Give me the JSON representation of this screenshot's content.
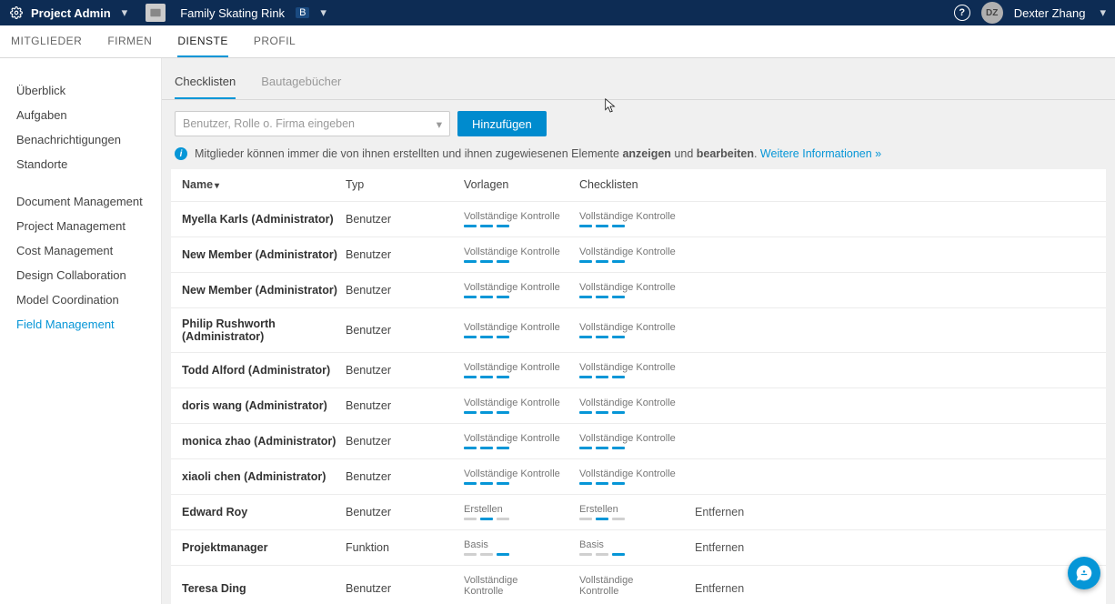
{
  "header": {
    "app_title": "Project Admin",
    "project_name": "Family Skating Rink",
    "project_badge": "B",
    "user_initials": "DZ",
    "user_name": "Dexter Zhang"
  },
  "top_tabs": [
    "MITGLIEDER",
    "FIRMEN",
    "DIENSTE",
    "PROFIL"
  ],
  "top_tab_active": 2,
  "sidebar": {
    "group1": [
      "Überblick",
      "Aufgaben",
      "Benachrichtigungen",
      "Standorte"
    ],
    "group2": [
      "Document Management",
      "Project Management",
      "Cost Management",
      "Design Collaboration",
      "Model Coordination",
      "Field Management"
    ],
    "active": "Field Management"
  },
  "content_tabs": [
    "Checklisten",
    "Bautagebücher"
  ],
  "content_tab_active": 0,
  "controls": {
    "placeholder": "Benutzer, Rolle o. Firma eingeben",
    "add_btn": "Hinzufügen"
  },
  "info": {
    "t1": "Mitglieder können immer die von ihnen erstellten und ihnen zugewiesenen Elemente ",
    "b1": "anzeigen",
    "t2": " und ",
    "b2": "bearbeiten",
    "t3": ". ",
    "link": "Weitere Informationen »"
  },
  "columns": {
    "name": "Name",
    "typ": "Typ",
    "vor": "Vorlagen",
    "chk": "Checklisten"
  },
  "perm_labels": {
    "full": "Vollständige Kontrolle",
    "create": "Erstellen",
    "basis": "Basis",
    "full_wrap": "Vollständige\nKontrolle"
  },
  "action_remove": "Entfernen",
  "rows": [
    {
      "name": "Myella Karls (Administrator)",
      "typ": "Benutzer",
      "vor": "full3",
      "chk": "full3",
      "act": ""
    },
    {
      "name": "New Member (Administrator)",
      "typ": "Benutzer",
      "vor": "full3",
      "chk": "full3",
      "act": ""
    },
    {
      "name": "New Member (Administrator)",
      "typ": "Benutzer",
      "vor": "full3",
      "chk": "full3",
      "act": ""
    },
    {
      "name": "Philip Rushworth (Administrator)",
      "typ": "Benutzer",
      "vor": "full3",
      "chk": "full3",
      "act": ""
    },
    {
      "name": "Todd Alford (Administrator)",
      "typ": "Benutzer",
      "vor": "full3",
      "chk": "full3",
      "act": ""
    },
    {
      "name": "doris wang (Administrator)",
      "typ": "Benutzer",
      "vor": "full3",
      "chk": "full3",
      "act": ""
    },
    {
      "name": "monica zhao (Administrator)",
      "typ": "Benutzer",
      "vor": "full3",
      "chk": "full3",
      "act": ""
    },
    {
      "name": "xiaoli chen (Administrator)",
      "typ": "Benutzer",
      "vor": "full3",
      "chk": "full3",
      "act": ""
    },
    {
      "name": "Edward Roy",
      "typ": "Benutzer",
      "vor": "create",
      "chk": "create",
      "act": "Entfernen"
    },
    {
      "name": "Projektmanager",
      "typ": "Funktion",
      "vor": "basis",
      "chk": "basis",
      "act": "Entfernen"
    },
    {
      "name": "Teresa Ding",
      "typ": "Benutzer",
      "vor": "full_wrap",
      "chk": "full_wrap",
      "act": "Entfernen"
    }
  ]
}
